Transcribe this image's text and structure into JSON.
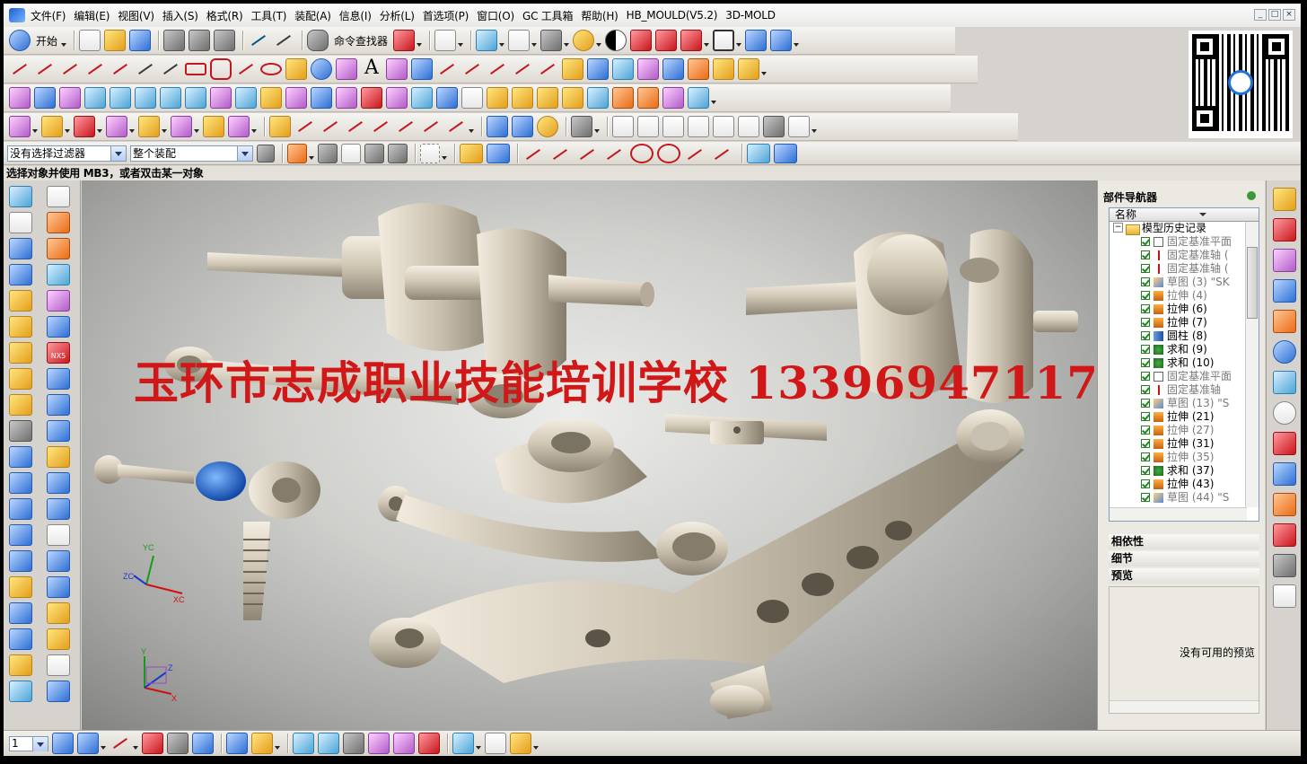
{
  "menubar": {
    "items": [
      "文件(F)",
      "编辑(E)",
      "视图(V)",
      "插入(S)",
      "格式(R)",
      "工具(T)",
      "装配(A)",
      "信息(I)",
      "分析(L)",
      "首选项(P)",
      "窗口(O)",
      "GC 工具箱",
      "帮助(H)",
      "HB_MOULD(V5.2)",
      "3D-MOLD"
    ],
    "window_controls": [
      "_",
      "□",
      "×"
    ]
  },
  "toolbar1": {
    "start_label": "开始",
    "command_finder_label": "命令查找器"
  },
  "selection_bar": {
    "filter_value": "没有选择过滤器",
    "scope_value": "整个装配"
  },
  "status": {
    "message": "选择对象并使用 MB3，或者双击某一对象"
  },
  "viewport": {
    "watermark": "玉环市志成职业技能培训学校  13396947117",
    "triad_labels": [
      "YC",
      "ZC",
      "XC"
    ],
    "wcs_labels": [
      "Y",
      "Z",
      "X"
    ],
    "nx5_tag": "NX5"
  },
  "navigator": {
    "title": "部件导航器",
    "column_name": "名称",
    "root": "模型历史记录",
    "rows": [
      {
        "icon": "plane",
        "text": "固定基准平面",
        "dim": true
      },
      {
        "icon": "axis",
        "text": "固定基准轴 (",
        "dim": true
      },
      {
        "icon": "axis",
        "text": "固定基准轴 (",
        "dim": true
      },
      {
        "icon": "sketch",
        "text": "草图 (3) \"SK",
        "dim": true
      },
      {
        "icon": "extrude",
        "text": "拉伸 (4)",
        "dim": true
      },
      {
        "icon": "extrude",
        "text": "拉伸 (6)",
        "dim": false
      },
      {
        "icon": "extrude",
        "text": "拉伸 (7)",
        "dim": false
      },
      {
        "icon": "cyl",
        "text": "圆柱 (8)",
        "dim": false
      },
      {
        "icon": "unite",
        "text": "求和 (9)",
        "dim": false
      },
      {
        "icon": "unite",
        "text": "求和 (10)",
        "dim": false
      },
      {
        "icon": "plane",
        "text": "固定基准平面",
        "dim": true
      },
      {
        "icon": "axis",
        "text": "固定基准轴",
        "dim": true
      },
      {
        "icon": "sketch",
        "text": "草图 (13) \"S",
        "dim": true
      },
      {
        "icon": "extrude",
        "text": "拉伸 (21)",
        "dim": false
      },
      {
        "icon": "extrude",
        "text": "拉伸 (27)",
        "dim": true
      },
      {
        "icon": "extrude",
        "text": "拉伸 (31)",
        "dim": false
      },
      {
        "icon": "extrude",
        "text": "拉伸 (35)",
        "dim": true
      },
      {
        "icon": "unite",
        "text": "求和 (37)",
        "dim": false
      },
      {
        "icon": "extrude",
        "text": "拉伸 (43)",
        "dim": false
      },
      {
        "icon": "sketch",
        "text": "草图 (44) \"S",
        "dim": true
      }
    ],
    "sections": [
      "相依性",
      "细节",
      "预览"
    ],
    "preview_message": "没有可用的预览"
  },
  "bottom": {
    "layer_value": "1"
  },
  "colors": {
    "watermark": "#d01818",
    "viewport_center": "#ececea",
    "viewport_edge": "#7d7d7b",
    "part_metal": "#c9bfae"
  },
  "icons": [
    "app-logo-icon",
    "new-file-icon",
    "open-folder-icon",
    "save-icon",
    "cut-icon",
    "copy-icon",
    "paste-icon",
    "undo-icon",
    "redo-icon",
    "binoculars-icon",
    "qr-code-icon",
    "part-navigator-icon"
  ]
}
